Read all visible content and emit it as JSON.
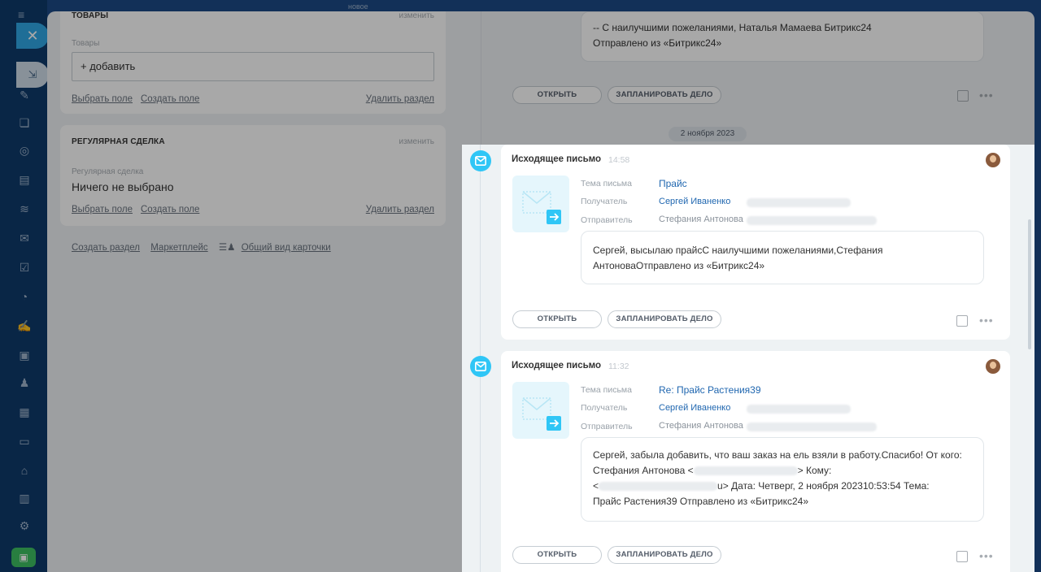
{
  "left_card_goods": {
    "header": "ТОВАРЫ",
    "edit": "изменить",
    "field_label": "Товары",
    "add_button": "+ добавить",
    "select_field": "Выбрать поле",
    "create_field": "Создать поле",
    "delete_section": "Удалить раздел"
  },
  "left_card_regular": {
    "header": "РЕГУЛЯРНАЯ СДЕЛКА",
    "edit": "изменить",
    "field_label": "Регулярная сделка",
    "value": "Ничего не выбрано",
    "select_field": "Выбрать поле",
    "create_field": "Создать поле",
    "delete_section": "Удалить раздел"
  },
  "footer_links": {
    "create_section": "Создать раздел",
    "marketplace": "Маркетплейс",
    "card_view": "Общий вид карточки"
  },
  "top_email": {
    "line1": "-- С наилучшими пожеланиями, Наталья Мамаева  Битрикс24",
    "line2": "Отправлено из «Битрикс24»",
    "open_button": "ОТКРЫТЬ",
    "schedule_button": "ЗАПЛАНИРОВАТЬ ДЕЛО"
  },
  "date_separator": "2 ноября 2023",
  "labels": {
    "subject": "Тема письма",
    "recipient": "Получатель",
    "sender": "Отправитель"
  },
  "items": [
    {
      "title": "Исходящее письмо",
      "time": "14:58",
      "subject": "Прайс",
      "recipient": "Сергей Иваненко",
      "sender": "Стефания Антонова",
      "body": "Сергей, высылаю прайсС наилучшими пожеланиями,Стефания АнтоноваОтправлено из «Битрикс24»",
      "open_button": "ОТКРЫТЬ",
      "schedule_button": "ЗАПЛАНИРОВАТЬ ДЕЛО"
    },
    {
      "title": "Исходящее письмо",
      "time": "11:32",
      "subject": "Re: Прайс Растения39",
      "recipient": "Сергей Иваненко",
      "sender": "Стефания Антонова",
      "body_part1": "Сергей, забыла добавить, что ваш заказ на ель взяли в работу.Спасибо! От кого: Стефания Антонова <",
      "body_part2": "> Кому:",
      "body_part3": "<",
      "body_part4": "u> Дата: Четверг, 2 ноября 202310:53:54 Тема:",
      "body_part5": "Прайс Растения39 Отправлено из «Битрикс24»",
      "open_button": "ОТКРЫТЬ",
      "schedule_button": "ЗАПЛАНИРОВАТЬ ДЕЛО"
    }
  ],
  "rail_top_label": "новое",
  "colors": {
    "accent": "#2fc6f6",
    "link": "#2067b0",
    "nav_bg": "#0f3a6b",
    "close_btn": "#2fa8e6"
  },
  "icons": [
    "hamburger-icon",
    "close-icon",
    "pin-icon",
    "mail-icon",
    "avatar",
    "comment-icon",
    "more-icon",
    "settings-icon"
  ]
}
